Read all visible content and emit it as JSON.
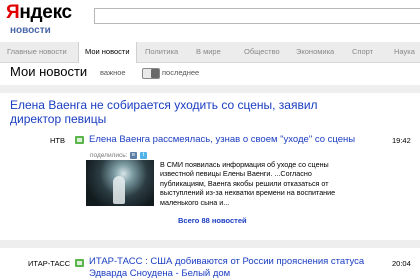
{
  "header": {
    "logo_first": "Я",
    "logo_rest": "ндекс",
    "subtitle": "новости",
    "search": {
      "value": "",
      "placeholder": ""
    }
  },
  "nav": {
    "items": [
      {
        "label": "Главные новости"
      },
      {
        "label": "Мои новости"
      },
      {
        "label": "Политика"
      },
      {
        "label": "В мире"
      },
      {
        "label": "Общество"
      },
      {
        "label": "Экономика"
      },
      {
        "label": "Спорт"
      },
      {
        "label": "Наука"
      }
    ],
    "active_index": 1
  },
  "page": {
    "title": "Мои новости",
    "toggle_left": "важное",
    "toggle_right": "последнее"
  },
  "stories": [
    {
      "headline": "Елена Ваенга не собирается уходить со сцены, заявил директор певицы",
      "source": "НТВ",
      "subhead": "Елена Ваенга рассмеялась, узнав о своем \"уходе\" со сцены",
      "time": "19:42",
      "share_label": "поделились:",
      "snippet": "В СМИ появилась информация об уходе со сцены известной певицы Елены Ваенги. ...Согласно публикациям, Ваенга якобы решили отказаться от выступлений из-за нехватки времени на воспитание маленького сына и...",
      "all_news": "Всего 88 новостей"
    },
    {
      "source": "ИТАР-ТАСС",
      "subhead_line1": "ИТАР-ТАСС : США добиваются от России прояснения статуса",
      "subhead_line2": "Эдварда Сноудена - Белый дом",
      "time": "20:04"
    }
  ],
  "colors": {
    "link": "#1a3dc1",
    "brand_red": "#e00000",
    "nav_bg": "#ececec",
    "source_icon": "#5ab64a"
  },
  "icons": {
    "source": "green-square-icon",
    "vk": "vk-icon",
    "twitter": "twitter-bird-icon"
  }
}
